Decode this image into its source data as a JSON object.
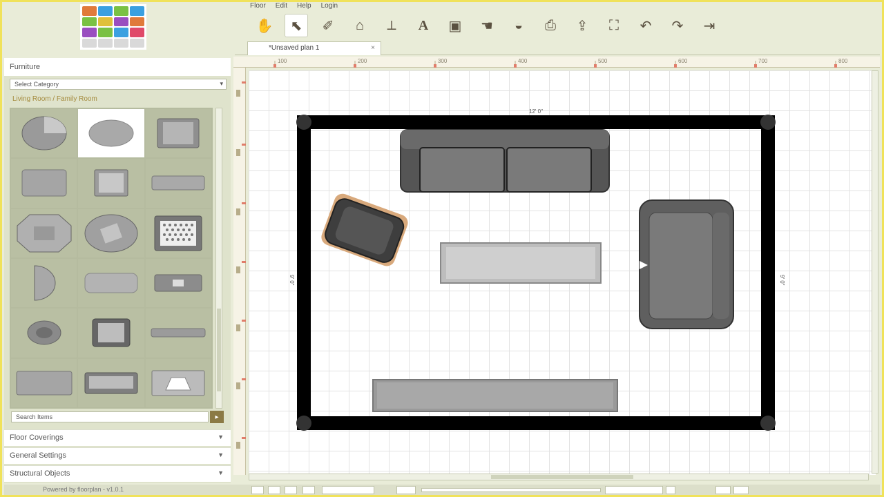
{
  "app": {
    "logo_name": "app-logo",
    "accent": "#8b7a45"
  },
  "menu": {
    "items": [
      "Floor",
      "Edit",
      "Help",
      "Login"
    ]
  },
  "toolbar": {
    "tools": [
      {
        "name": "select-icon",
        "glyph": "✋"
      },
      {
        "name": "pointer-icon",
        "glyph": "⬉",
        "active": true
      },
      {
        "name": "draw-wall-icon",
        "glyph": "✐"
      },
      {
        "name": "draw-room-icon",
        "glyph": "⌂"
      },
      {
        "name": "dimension-icon",
        "glyph": "⟂"
      },
      {
        "name": "text-icon",
        "glyph": "A"
      },
      {
        "name": "door-icon",
        "glyph": "▣"
      },
      {
        "name": "pan-icon",
        "glyph": "☚"
      },
      {
        "name": "fill-icon",
        "glyph": "◒"
      },
      {
        "name": "print-icon",
        "glyph": "⎙"
      },
      {
        "name": "export-icon",
        "glyph": "⇪"
      },
      {
        "name": "fit-icon",
        "glyph": "⛶"
      },
      {
        "name": "undo-icon",
        "glyph": "↶"
      },
      {
        "name": "redo-icon",
        "glyph": "↷"
      },
      {
        "name": "exit-icon",
        "glyph": "⇥"
      }
    ]
  },
  "tab": {
    "label": "*Unsaved plan 1",
    "close": "×"
  },
  "sidebar": {
    "title": "Furniture",
    "category_select": "Select Category",
    "breadcrumb": "Living Room / Family Room",
    "search_placeholder": "Search Items",
    "search_button": "▸",
    "sections": [
      {
        "label": "Floor Coverings",
        "chev": "▼"
      },
      {
        "label": "General Settings",
        "chev": "▼"
      },
      {
        "label": "Structural Objects",
        "chev": "▼"
      }
    ]
  },
  "status": {
    "powered_by": "Powered by floorplan - v1.0.1"
  },
  "ruler": {
    "top": [
      "100",
      "200",
      "300",
      "400",
      "500",
      "600",
      "700",
      "800"
    ]
  },
  "plan": {
    "width_label": "12' 0\"",
    "height_label": "9' 0\""
  }
}
